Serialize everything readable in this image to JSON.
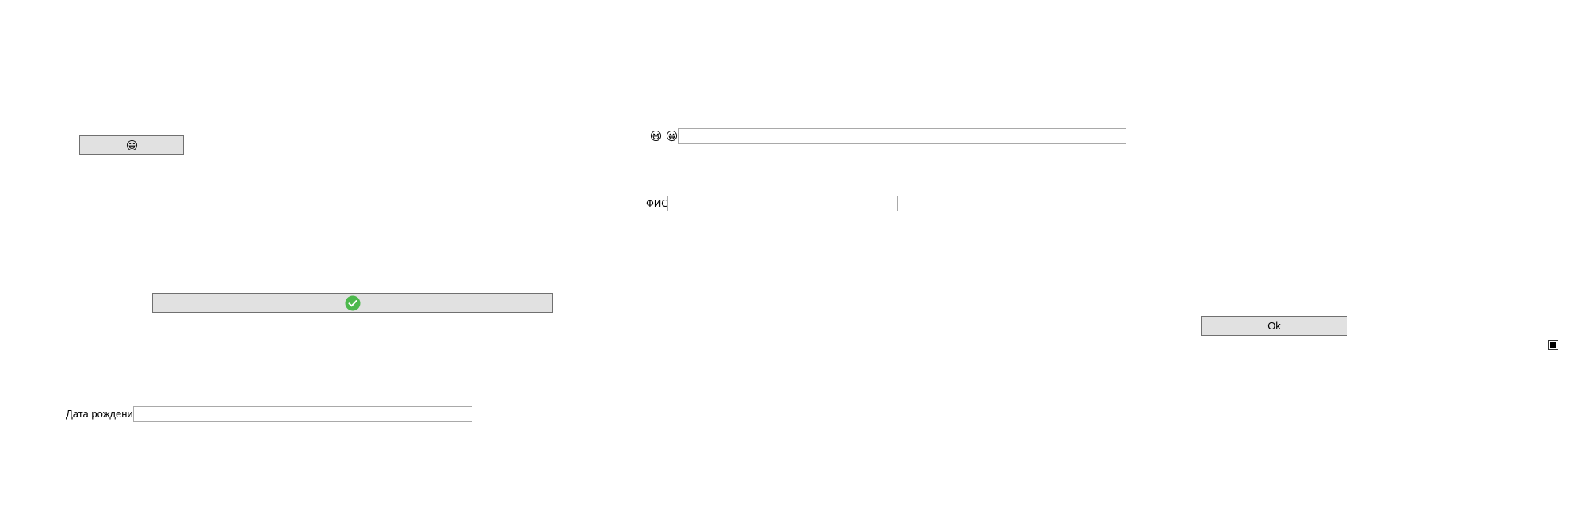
{
  "buttons": {
    "emoji_button": {
      "icon": "grinning-face-with-sweat-icon"
    },
    "confirm_button": {
      "icon": "check-circle-icon",
      "icon_color": "#4cb84c"
    },
    "ok_button": {
      "label": "Ok"
    }
  },
  "fields": {
    "emoji_row": {
      "icons": [
        "laughing-face-icon",
        "grinning-face-icon"
      ],
      "value": ""
    },
    "fio": {
      "label": "ФИО",
      "value": ""
    },
    "birth_date": {
      "label": "Дата рождения",
      "value": ""
    }
  },
  "checkbox": {
    "checked": true
  },
  "colors": {
    "button_bg": "#e1e1e1",
    "button_border": "#707070",
    "field_border": "#a9a9a9"
  }
}
